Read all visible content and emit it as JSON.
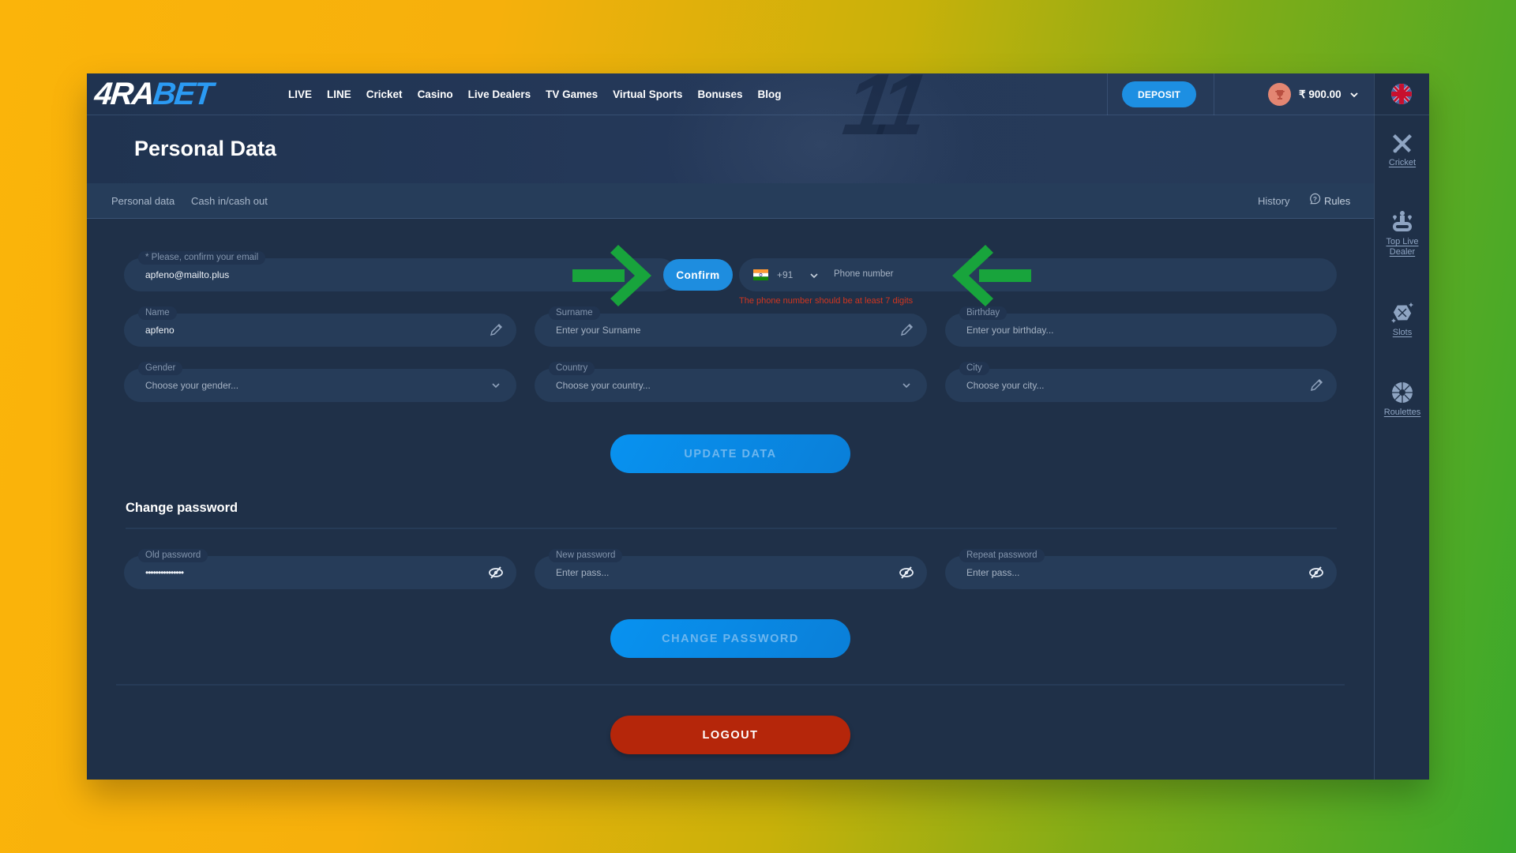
{
  "header": {
    "logo": {
      "part1": "4RA",
      "part2": "BET"
    },
    "nav": [
      "LIVE",
      "LINE",
      "Cricket",
      "Casino",
      "Live Dealers",
      "TV Games",
      "Virtual Sports",
      "Bonuses",
      "Blog"
    ],
    "deposit_label": "DEPOSIT",
    "balance": "₹ 900.00",
    "language_icon": "uk-flag-icon"
  },
  "page": {
    "title": "Personal Data",
    "tabs": [
      "Personal data",
      "Cash in/cash out"
    ],
    "history_label": "History",
    "rules_label": "Rules"
  },
  "sidebar": {
    "items": [
      {
        "label": "Cricket",
        "icon": "cricket-icon"
      },
      {
        "label": "Top Live Dealer",
        "icon": "live-dealer-icon"
      },
      {
        "label": "Slots",
        "icon": "slots-icon"
      },
      {
        "label": "Roulettes",
        "icon": "roulette-icon"
      }
    ]
  },
  "form": {
    "email": {
      "label": "* Please, confirm your email",
      "value": "apfeno@mailto.plus"
    },
    "confirm_label": "Confirm",
    "phone": {
      "country_code": "+91",
      "placeholder": "Phone number",
      "error": "The phone number should be at least 7 digits"
    },
    "name": {
      "label": "Name",
      "value": "apfeno"
    },
    "surname": {
      "label": "Surname",
      "placeholder": "Enter your Surname"
    },
    "birthday": {
      "label": "Birthday",
      "placeholder": "Enter your birthday..."
    },
    "gender": {
      "label": "Gender",
      "placeholder": "Choose your gender..."
    },
    "country": {
      "label": "Country",
      "placeholder": "Choose your country..."
    },
    "city": {
      "label": "City",
      "placeholder": "Choose your city..."
    },
    "update_label": "UPDATE DATA"
  },
  "password": {
    "title": "Change password",
    "old": {
      "label": "Old password",
      "value": "•••••••••••••••"
    },
    "new": {
      "label": "New password",
      "placeholder": "Enter pass..."
    },
    "repeat": {
      "label": "Repeat password",
      "placeholder": "Enter pass..."
    },
    "change_label": "CHANGE PASSWORD"
  },
  "logout_label": "LOGOUT",
  "colors": {
    "primary": "#1e8ddf",
    "logout": "#b5260a",
    "error": "#d2361f",
    "annotation_arrow": "#18a43c",
    "panel": "#1f3048",
    "field": "#263c59"
  }
}
